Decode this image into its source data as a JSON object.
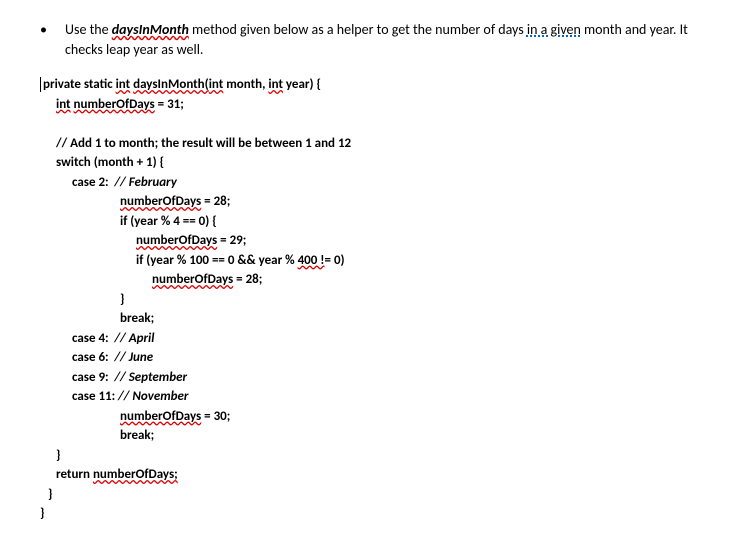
{
  "bullet": {
    "text_before": "Use the ",
    "method_name": "daysInMonth",
    "text_after_method": " method given below as a helper to get the number of days ",
    "in_a_given": "in a given",
    "text_end": " month and year.  It checks leap year as well."
  },
  "code": {
    "line1_private_static": "private static ",
    "line1_int": "int",
    "line1_space": " ",
    "line1_daysInMonth": "daysInMonth(",
    "line1_int2": "int",
    "line1_month": " month, ",
    "line1_int3": "int",
    "line1_year": " year) {",
    "line2_int": "int",
    "line2_space": " ",
    "line2_numberOfDays": "numberOfDays",
    "line2_rest": " = 31;",
    "line3_comment": "// Add 1 to month; the result will be between 1 and 12",
    "line4_switch": "switch (month + 1) {",
    "line5_case2": "case 2:  ",
    "line5_comment": "// February",
    "line6_numberOfDays": "numberOfDays",
    "line6_rest": " = 28;",
    "line7_if": "if (year % 4 == 0) {",
    "line8_numberOfDays": "numberOfDays",
    "line8_rest": " = 29;",
    "line9_if_part1": "if (year % 100 == 0 && year % ",
    "line9_400": "400 !",
    "line9_rest": "= 0)",
    "line10_numberOfDays": "numberOfDays",
    "line10_rest": " = 28;",
    "line11_brace": "}",
    "line12_break": "break;",
    "line13_case4": "case 4:  ",
    "line13_comment": "// April",
    "line14_case6": "case 6:  ",
    "line14_comment": "// June",
    "line15_case9": "case 9:  ",
    "line15_comment": "// September",
    "line16_case11": "case 11: ",
    "line16_comment": "// November",
    "line17_numberOfDays": "numberOfDays",
    "line17_rest": " = 30;",
    "line18_break": "break;",
    "line19_brace": "}",
    "line20_return": "return ",
    "line20_numberOfDays": "numberOfDays;",
    "line21_brace": "}",
    "line22_brace": "}"
  }
}
